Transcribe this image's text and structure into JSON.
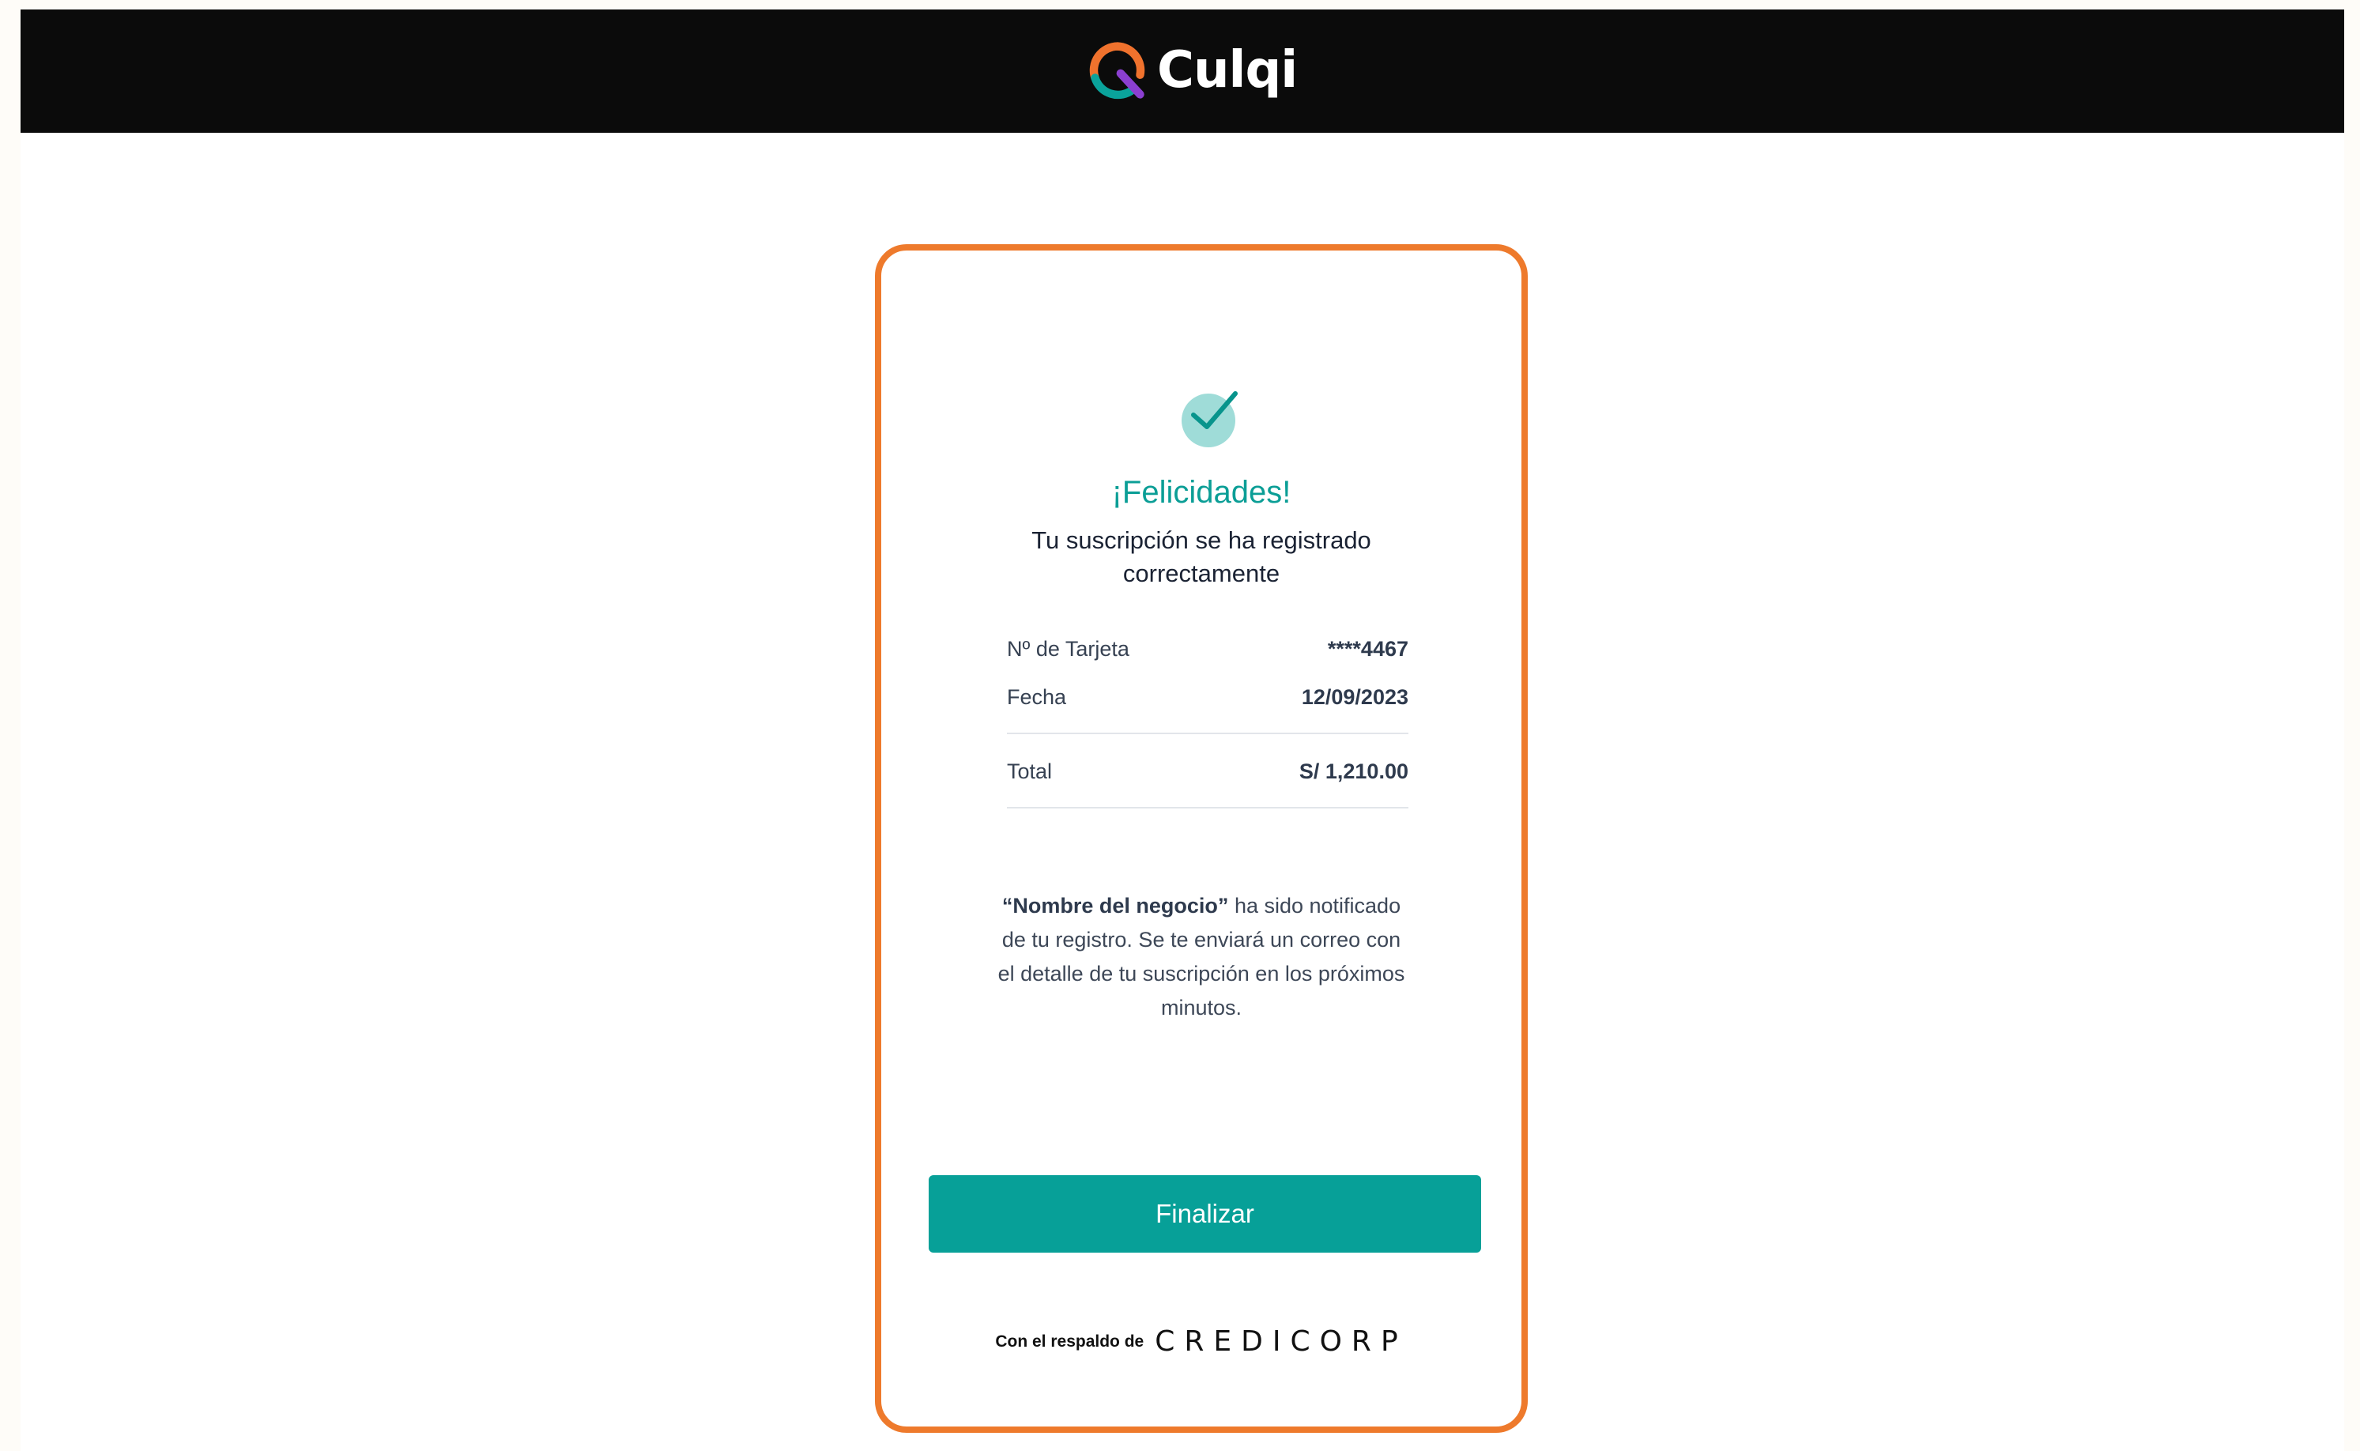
{
  "header": {
    "brand_name": "Culqi",
    "brand_colors": {
      "orange": "#f0722d",
      "teal": "#0aa39b",
      "purple": "#8b3fd0"
    }
  },
  "confirmation": {
    "title": "¡Felicidades!",
    "subtitle": "Tu suscripción se ha registrado correctamente",
    "details": {
      "card_label": "Nº de Tarjeta",
      "card_value": "****4467",
      "date_label": "Fecha",
      "date_value": "12/09/2023",
      "total_label": "Total",
      "total_value": "S/ 1,210.00"
    },
    "notice": {
      "business_name": "“Nombre del negocio”",
      "message": " ha sido notificado de tu registro. Se te enviará un correo con el detalle de tu suscripción en los próximos minutos."
    },
    "finish_button_label": "Finalizar",
    "footer": {
      "prefix": "Con el respaldo de",
      "brand": "CREDICORP"
    }
  },
  "colors": {
    "accent": "#07a098",
    "card_border": "#ee7a2c",
    "header_bg": "#0b0b0b"
  }
}
